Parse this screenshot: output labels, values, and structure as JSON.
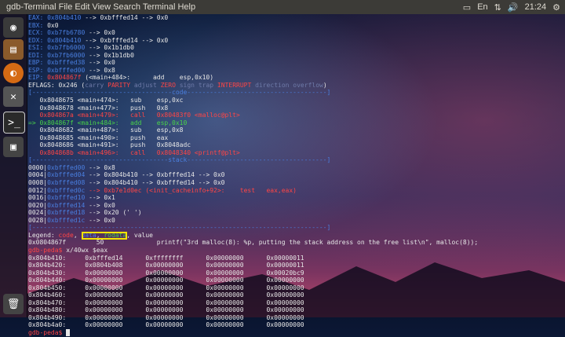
{
  "window": {
    "title": "gdb-Terminal File Edit View Search Terminal Help",
    "time": "21:24",
    "keyboard": "En",
    "menu": [
      "File",
      "Edit",
      "View",
      "Search",
      "Terminal",
      "Help"
    ]
  },
  "launcher": {
    "items": [
      "dash-icon",
      "files-icon",
      "firefox-icon",
      "settings-icon",
      "terminal-icon",
      "disk-icon",
      "trash-icon"
    ]
  },
  "registers": [
    {
      "name": "EAX:",
      "value": "0x804b410",
      "rest": "--> 0xbfffed14 --> 0x0"
    },
    {
      "name": "EBX:",
      "value": "0x0",
      "rest": ""
    },
    {
      "name": "ECX:",
      "value": "0xb7fb6780",
      "rest": "--> 0x0"
    },
    {
      "name": "EDX:",
      "value": "0x804b410",
      "rest": "--> 0xbfffed14 --> 0x0"
    },
    {
      "name": "ESI:",
      "value": "0xb7fb6000",
      "rest": "--> 0x1b1db0"
    },
    {
      "name": "EDI:",
      "value": "0xb7fb6000",
      "rest": "--> 0x1b1db0"
    },
    {
      "name": "EBP:",
      "value": "0xbfffed38",
      "rest": "--> 0x0"
    },
    {
      "name": "ESP:",
      "value": "0xbfffed00",
      "rest": "--> 0x8"
    },
    {
      "name": "EIP:",
      "value": "0x804867f",
      "rest": "(<main+484>:      add    esp,0x10)"
    }
  ],
  "eflags": {
    "prefix": "EFLAGS: 0x246 (",
    "carry": "carry",
    "parity": "PARITY",
    "adjust": "adjust",
    "zero": "ZERO",
    "sign": "sign",
    "trap": "trap",
    "interrupt": "INTERRUPT",
    "direction": "direction",
    "overflow": "overflow",
    "suffix": ")"
  },
  "code_separator": "[-------------------------------------code-------------------------------------]",
  "code": [
    {
      "addr": "0x8048675 <main+474>:",
      "op": "sub",
      "args": "esp,0xc"
    },
    {
      "addr": "0x8048678 <main+477>:",
      "op": "push",
      "args": "0x8"
    },
    {
      "addr": "0x804867a <main+479>:",
      "op": "call",
      "args": "0x80483f0 <malloc@plt>"
    },
    {
      "addr": "0x804867f <main+484>:",
      "op": "add",
      "args": "esp,0x10"
    },
    {
      "addr": "0x8048682 <main+487>:",
      "op": "sub",
      "args": "esp,0x8"
    },
    {
      "addr": "0x8048685 <main+490>:",
      "op": "push",
      "args": "eax"
    },
    {
      "addr": "0x8048686 <main+491>:",
      "op": "push",
      "args": "0x8048adc"
    },
    {
      "addr": "0x804868b <main+496>:",
      "op": "call",
      "args": "0x8048340 <printf@plt>"
    }
  ],
  "current_marker": "=>",
  "stack_separator": "[------------------------------------stack-------------------------------------]",
  "stack": [
    {
      "off": "0000|",
      "addr": "0xbfffed00",
      "rest": "--> 0x8"
    },
    {
      "off": "0004|",
      "addr": "0xbfffed04",
      "rest": "--> 0x804b410 --> 0xbfffed14 --> 0x0"
    },
    {
      "off": "0008|",
      "addr": "0xbfffed08",
      "rest": "--> 0x804b410 --> 0xbfffed14 --> 0x0"
    },
    {
      "off": "0012|",
      "addr": "0xbfffed0c",
      "rest": "--> 0xb7e1d0ec (<init_cacheinfo+92>:    test   eax,eax)"
    },
    {
      "off": "0016|",
      "addr": "0xbfffed10",
      "rest": "--> 0x1"
    },
    {
      "off": "0020|",
      "addr": "0xbfffed14",
      "rest": "--> 0x0"
    },
    {
      "off": "0024|",
      "addr": "0xbfffed18",
      "rest": "--> 0x20 (' ')"
    },
    {
      "off": "0028|",
      "addr": "0xbfffed1c",
      "rest": "--> 0x0"
    }
  ],
  "bottom_separator": "[------------------------------------------------------------------------------]",
  "legend": {
    "label": "Legend:",
    "code": "code",
    "data": "data",
    "rodata": "rodata",
    "value": "value"
  },
  "source_line": "0x0804867f        50              printf(\"3rd malloc(8): %p, putting the stack address on the free list\\n\", malloc(8));",
  "prompt": "gdb-peda$",
  "command": "x/40wx $eax",
  "memory": [
    {
      "addr": "0x804b410:",
      "w": [
        "0xbfffed14",
        "0xffffffff",
        "0x00000000",
        "0x00000011"
      ]
    },
    {
      "addr": "0x804b420:",
      "w": [
        "0x0804b408",
        "0x00000000",
        "0x00000000",
        "0x00000011"
      ]
    },
    {
      "addr": "0x804b430:",
      "w": [
        "0x00000000",
        "0x00000000",
        "0x00000000",
        "0x00020bc9"
      ]
    },
    {
      "addr": "0x804b440:",
      "w": [
        "0x00000000",
        "0x00000000",
        "0x00000000",
        "0x00000000"
      ]
    },
    {
      "addr": "0x804b450:",
      "w": [
        "0x00000000",
        "0x00000000",
        "0x00000000",
        "0x00000000"
      ]
    },
    {
      "addr": "0x804b460:",
      "w": [
        "0x00000000",
        "0x00000000",
        "0x00000000",
        "0x00000000"
      ]
    },
    {
      "addr": "0x804b470:",
      "w": [
        "0x00000000",
        "0x00000000",
        "0x00000000",
        "0x00000000"
      ]
    },
    {
      "addr": "0x804b480:",
      "w": [
        "0x00000000",
        "0x00000000",
        "0x00000000",
        "0x00000000"
      ]
    },
    {
      "addr": "0x804b490:",
      "w": [
        "0x00000000",
        "0x00000000",
        "0x00000000",
        "0x00000000"
      ]
    },
    {
      "addr": "0x804b4a0:",
      "w": [
        "0x00000000",
        "0x00000000",
        "0x00000000",
        "0x00000000"
      ]
    }
  ],
  "colors": {
    "register_name": "#4a7fe0",
    "pointer": "#4a7fe0",
    "eip": "#ff4545",
    "flag_set": "#ff4545",
    "current_instr": "#49d349",
    "separator": "#4a7fe0",
    "highlight_box": "#f5e300"
  }
}
